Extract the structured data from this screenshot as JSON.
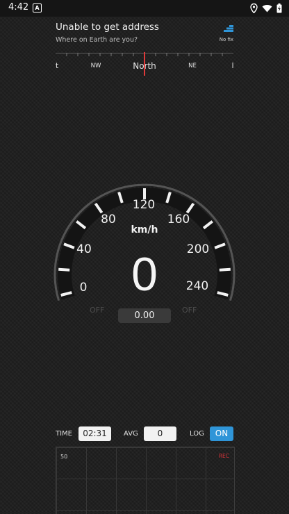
{
  "status_bar": {
    "time": "4:42",
    "notification_icon": "A"
  },
  "header": {
    "address_title": "Unable to get address",
    "address_subtitle": "Where on Earth are you?",
    "fix_status": "No fix"
  },
  "compass": {
    "labels": [
      "t",
      "NW",
      "North",
      "NE",
      "l"
    ]
  },
  "speedometer": {
    "unit": "km/h",
    "speed": "0",
    "scale_labels": [
      "0",
      "40",
      "80",
      "120",
      "160",
      "200",
      "240"
    ],
    "odometer": "0.00",
    "left_off": "OFF",
    "right_off": "OFF"
  },
  "stats": {
    "time_label": "TIME",
    "time_value": "02:31",
    "avg_label": "AVG",
    "avg_value": "0",
    "log_label": "LOG",
    "log_toggle": "ON"
  },
  "graph": {
    "max_label": "50",
    "rec_label": "REC"
  },
  "colors": {
    "accent": "#2f95d8",
    "needle": "#e03a3a",
    "rec": "#d8343a"
  }
}
